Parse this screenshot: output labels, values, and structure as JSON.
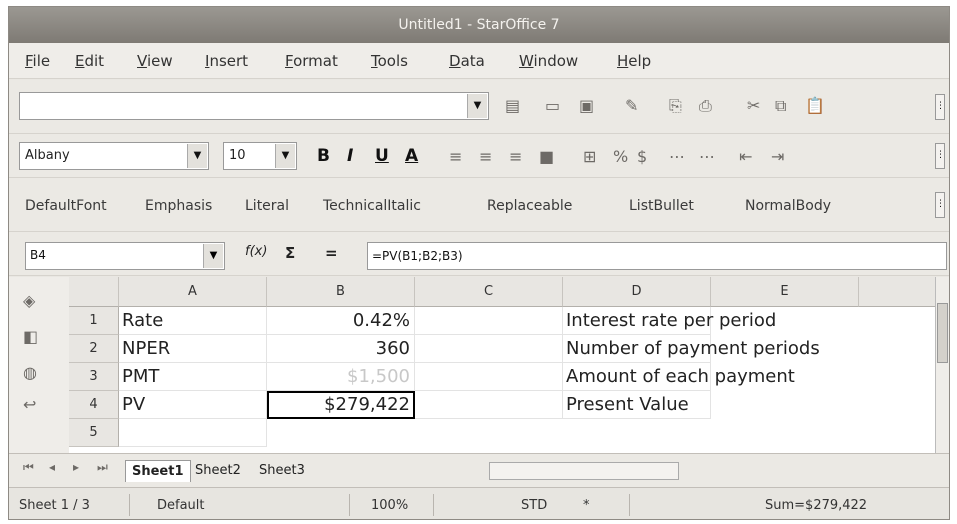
{
  "window": {
    "title": "Untitled1 - StarOffice 7"
  },
  "menu": [
    "File",
    "Edit",
    "View",
    "Insert",
    "Format",
    "Tools",
    "Data",
    "Window",
    "Help"
  ],
  "font": {
    "name": "Albany",
    "size": "10"
  },
  "format_buttons": {
    "bold": "B",
    "italic": "I",
    "underline": "U",
    "font_color": "A"
  },
  "styles": [
    "DefaultFont",
    "Emphasis",
    "Literal",
    "TechnicalItalic",
    "Replaceable",
    "ListBullet",
    "NormalBody"
  ],
  "formula_bar": {
    "cell_ref": "B4",
    "function_symbol": "f(x)",
    "sum_symbol": "Σ",
    "equals_symbol": "=",
    "formula": "=PV(B1;B2;B3)"
  },
  "columns": [
    "A",
    "B",
    "C",
    "D",
    "E"
  ],
  "rows": [
    {
      "num": "1",
      "a": "Rate",
      "b": "0.42%",
      "d": "Interest rate per period"
    },
    {
      "num": "2",
      "a": "NPER",
      "b": "360",
      "d": "Number of payment periods"
    },
    {
      "num": "3",
      "a": "PMT",
      "b": "$1,500",
      "d": "Amount of each payment"
    },
    {
      "num": "4",
      "a": "PV",
      "b": "$279,422",
      "d": "Present Value"
    },
    {
      "num": "5",
      "a": "",
      "b": "",
      "d": ""
    }
  ],
  "sheet_tabs": [
    "Sheet1",
    "Sheet2",
    "Sheet3"
  ],
  "status": {
    "sheet": "Sheet 1 / 3",
    "page_style": "Default",
    "zoom": "100%",
    "mode": "STD",
    "selection_mode": "*",
    "sum": "Sum=$279,422"
  }
}
